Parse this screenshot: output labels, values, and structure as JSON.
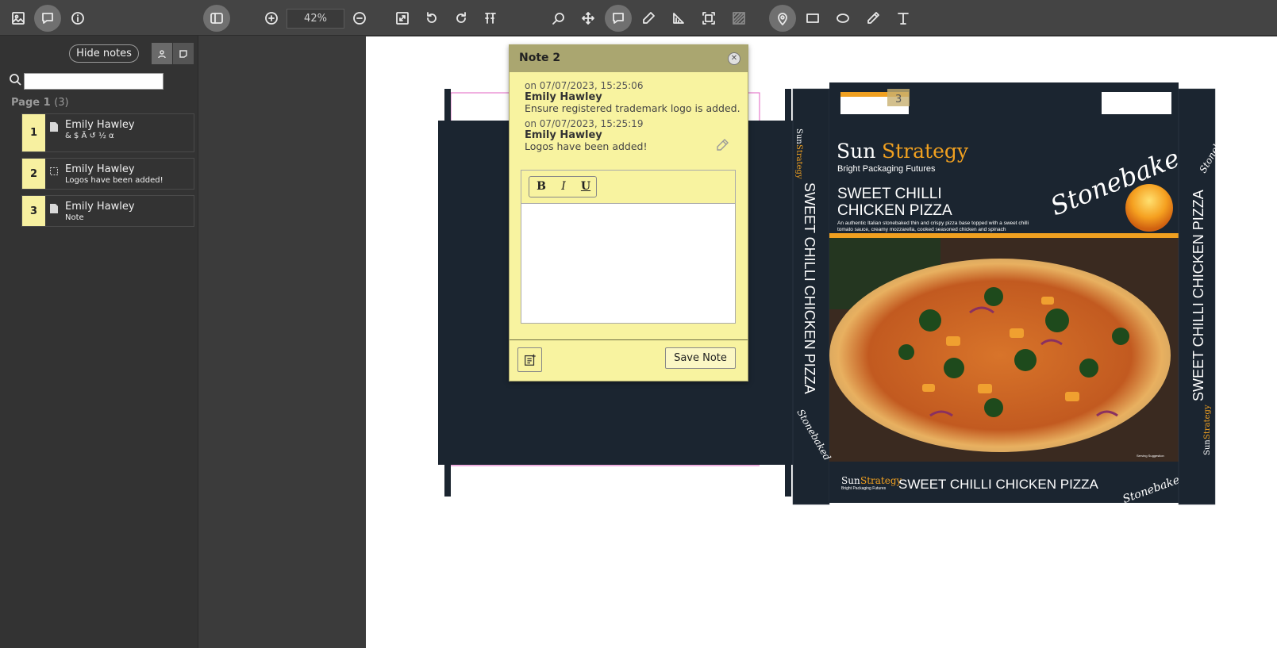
{
  "toolbar": {
    "zoom_value": "42%",
    "buttons": [
      "image-icon",
      "comment-icon",
      "info-icon",
      "sidebar-toggle-icon",
      "zoom-in-icon",
      "zoom-out-icon",
      "fit-page-icon",
      "rotate-left-icon",
      "rotate-right-icon",
      "compare-icon",
      "search-icon",
      "pan-icon",
      "comment-tool-icon",
      "pen-icon",
      "measure-icon",
      "crop-icon",
      "pattern-icon",
      "pin-icon",
      "rectangle-icon",
      "ellipse-icon",
      "pencil-icon",
      "text-icon"
    ]
  },
  "sidebar": {
    "hide_notes_label": "Hide notes",
    "search_placeholder": "",
    "page_label": "Page 1",
    "page_count": "(3)",
    "notes": [
      {
        "number": "1",
        "author": "Emily Hawley",
        "summary": "& $ Ã ↺ ½ α"
      },
      {
        "number": "2",
        "author": "Emily Hawley",
        "summary": "Logos have been added!"
      },
      {
        "number": "3",
        "author": "Emily Hawley",
        "summary": "Note"
      }
    ]
  },
  "note_panel": {
    "title": "Note 2",
    "entries": [
      {
        "date": "on 07/07/2023, 15:25:06",
        "author": "Emily Hawley",
        "text": "Ensure registered trademark logo is added."
      },
      {
        "date": "on 07/07/2023, 15:25:19",
        "author": "Emily Hawley",
        "text": "Logos have been added!"
      }
    ],
    "format_bold": "B",
    "format_italic": "I",
    "format_underline": "U",
    "save_label": "Save Note"
  },
  "artwork": {
    "brand_sun": "Sun",
    "brand_strategy": "Strategy",
    "tagline": "Bright Packaging Futures",
    "product_line1": "SWEET CHILLI",
    "product_line2": "CHICKEN PIZZA",
    "product_full": "SWEET CHILLI CHICKEN PIZZA",
    "description_line1": "An authentic Italian stonebaked thin and crispy pizza base topped with a sweet chilli",
    "description_line2": "tomato sauce, creamy mozzarella, cooked seasoned chicken and spinach",
    "script_logo": "Stonebaked",
    "serving": "Serving Suggestion",
    "marker_number": "3",
    "colors": {
      "navy": "#1b2530",
      "orange": "#f0a020",
      "magenta": "#e060c0"
    }
  }
}
